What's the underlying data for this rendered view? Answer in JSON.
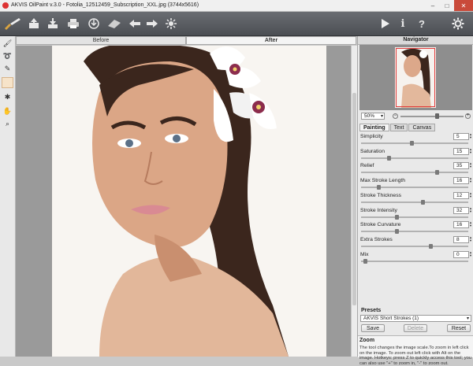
{
  "window": {
    "title": "AKVIS OilPaint v.3.0 - Fotolia_12512459_Subscription_XXL.jpg (3744x5616)",
    "controls": [
      "–",
      "□",
      "✕"
    ]
  },
  "toolbar": {
    "left_icons": [
      "brush-logo-icon",
      "open-file-icon",
      "save-file-icon",
      "print-icon",
      "share-icon",
      "erase-icon",
      "undo-icon",
      "redo-icon",
      "run-processing-icon"
    ],
    "right_icons": [
      "start-icon",
      "info-icon",
      "help-icon",
      "settings-icon"
    ]
  },
  "tools": [
    "brush-tool-icon",
    "direction-tool-icon",
    "eraser-tool-icon",
    "blank-tool-icon",
    "magic-tool-icon",
    "hand-tool-icon",
    "zoom-tool-icon"
  ],
  "view_tabs": {
    "before": "Before",
    "after": "After"
  },
  "navigator": {
    "title": "Navigator",
    "zoom": "50%"
  },
  "panel_tabs": {
    "painting": "Painting",
    "text": "Text",
    "canvas": "Canvas"
  },
  "params": [
    {
      "label": "Simplicity",
      "value": "5",
      "level": 0.47
    },
    {
      "label": "Saturation",
      "value": "15",
      "level": 0.25
    },
    {
      "label": "Relief",
      "value": "35",
      "level": 0.72
    },
    {
      "label": "Max Stroke Length",
      "value": "16",
      "level": 0.15
    },
    {
      "label": "Stroke Thickness",
      "value": "12",
      "level": 0.58
    },
    {
      "label": "Stroke Intensity",
      "value": "32",
      "level": 0.33
    },
    {
      "label": "Stroke Curvature",
      "value": "16",
      "level": 0.33
    },
    {
      "label": "Extra Strokes",
      "value": "8",
      "level": 0.66
    },
    {
      "label": "Mix",
      "value": "0",
      "level": 0.02
    }
  ],
  "presets": {
    "title": "Presets",
    "selected": "AKVIS Short Strokes (1)",
    "save": "Save",
    "delete": "Delete",
    "reset": "Reset"
  },
  "help": {
    "title": "Zoom",
    "text": "The tool changes the image scale.To zoom in left click on the image. To zoom out left click with Alt on the image. Hotkeys: press Z to quickly access this tool; you can also use \"+\" to zoom in, \"-\" to zoom out."
  }
}
